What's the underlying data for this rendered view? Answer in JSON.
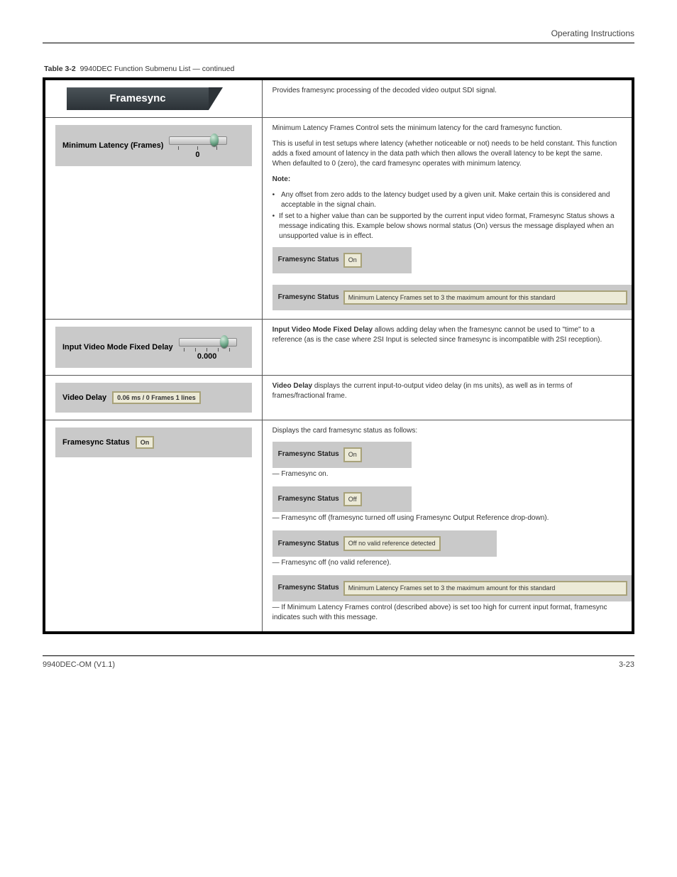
{
  "header": {
    "left": "",
    "right": "Operating Instructions"
  },
  "caption_prefix": "Table 3-2",
  "caption_title": "9940DEC Function Submenu List — continued",
  "tab": {
    "title": "Framesync"
  },
  "row1": {
    "right_text": "Provides framesync processing of the decoded video output SDI signal."
  },
  "row2": {
    "left_label": "Minimum Latency (Frames)",
    "left_value": "0",
    "right": {
      "p1": "Minimum Latency Frames Control sets the minimum latency for the card framesync function.",
      "p2": "This is useful in test setups where latency (whether noticeable or not) needs to be held constant. This function adds a fixed amount of latency in the data path which then allows the overall latency to be kept the same. When defaulted to 0 (zero), the card framesync operates with minimum latency.",
      "p3_strong": "Note:",
      "p3_bullet1": "Any offset from zero adds to the latency budget used by a given unit. Make certain this is considered and acceptable in the signal chain.",
      "p3_bullet2": "If set to a higher value than can be supported by the current input video format, Framesync Status shows a message indicating this. Example below shows normal status (On) versus the message displayed when an unsupported value is in effect.",
      "status_on_label": "Framesync Status",
      "status_on_value": "On",
      "status_msg_label": "Framesync Status",
      "status_msg_value": "Minimum Latency Frames set to 3 the maximum amount for this standard"
    }
  },
  "row3": {
    "left_label": "Input Video Mode Fixed Delay",
    "left_value": "0.000",
    "right": {
      "p1_strong": "Input Video Mode Fixed Delay",
      "p1_rest": " allows adding delay when the framesync cannot be used to \"time\" to a reference (as is the case where 2SI Input is selected since framesync is incompatible with 2SI reception)."
    }
  },
  "row4": {
    "left_label": "Video Delay",
    "left_value": "0.06 ms / 0 Frames 1 lines",
    "right": {
      "p1_strong": "Video Delay",
      "p1_rest": " displays the current input-to-output video delay (in ms units), as well as in terms of frames/fractional frame."
    }
  },
  "row5": {
    "left_label": "Framesync Status",
    "left_value": "On",
    "right": {
      "intro": "Displays the card framesync status as follows:",
      "r1_label": "Framesync Status",
      "r1_value": "On",
      "r1_desc": " — Framesync on.",
      "r2_label": "Framesync Status",
      "r2_value": "Off",
      "r2_desc": " — Framesync off (framesync turned off using Framesync Output Reference drop-down).",
      "r3_label": "Framesync Status",
      "r3_value": "Off no valid reference detected",
      "r3_desc": " — Framesync off (no valid reference).",
      "r4_label": "Framesync Status",
      "r4_value": "Minimum Latency Frames set to 3 the maximum amount for this standard",
      "r4_desc": " — If Minimum Latency Frames control (described above) is set too high for current input format, framesync indicates such with this message."
    }
  },
  "footer": {
    "left": "9940DEC-OM (V1.1)",
    "right": "3-23"
  }
}
